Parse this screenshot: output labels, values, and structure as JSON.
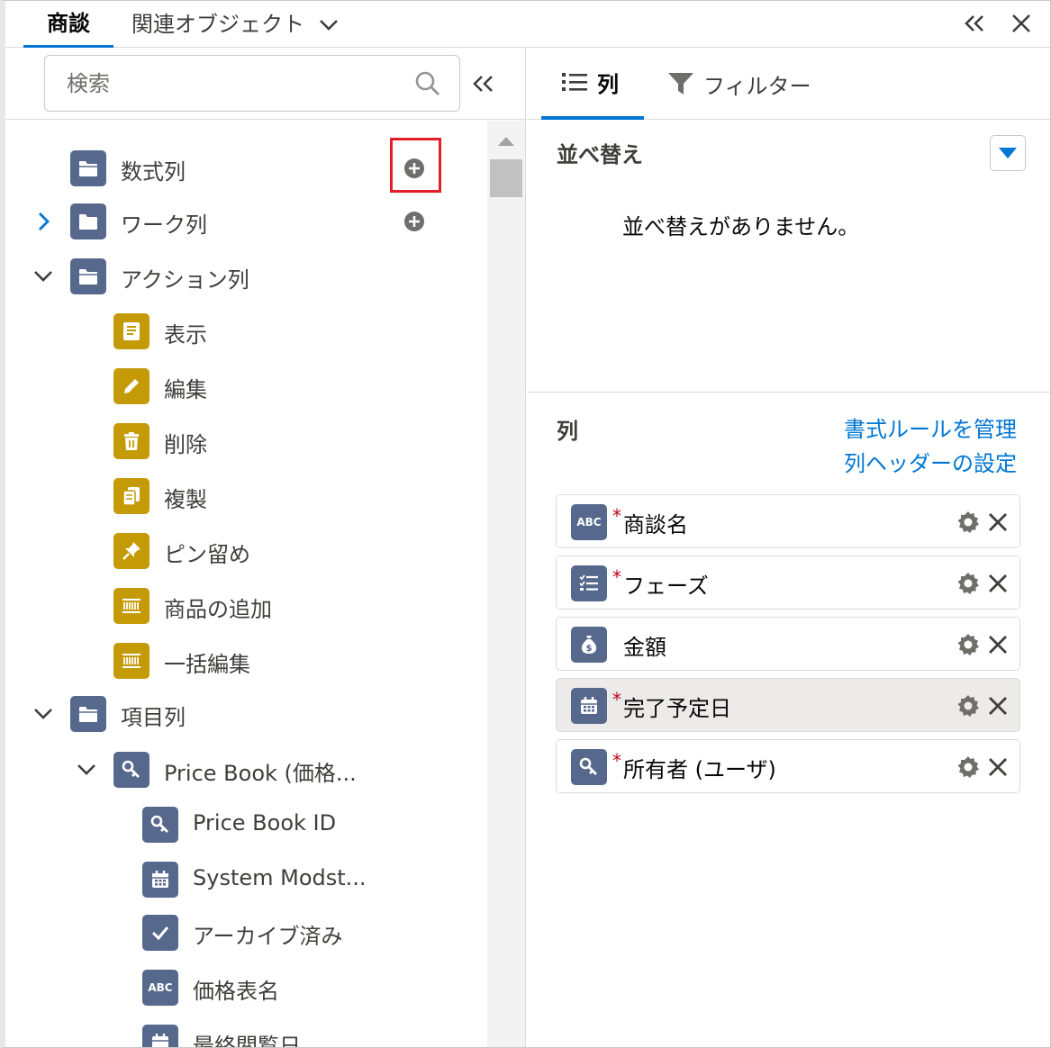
{
  "top_tabs": {
    "main": "商談",
    "related": "関連オブジェクト"
  },
  "search": {
    "placeholder": "検索"
  },
  "tree": [
    {
      "label": "数式列",
      "icon": "folder-icon",
      "icon_color": "#56688c",
      "expander": "none",
      "add": true
    },
    {
      "label": "ワーク列",
      "icon": "folder-icon",
      "icon_color": "#56688c",
      "expander": "collapsed",
      "add": true
    },
    {
      "label": "アクション列",
      "icon": "folder-icon",
      "icon_color": "#56688c",
      "expander": "expanded",
      "add": false
    },
    {
      "label": "表示",
      "icon": "record-view-icon",
      "icon_color": "#c49b07"
    },
    {
      "label": "編集",
      "icon": "pencil-icon",
      "icon_color": "#c49b07"
    },
    {
      "label": "削除",
      "icon": "trash-icon",
      "icon_color": "#c49b07"
    },
    {
      "label": "複製",
      "icon": "copy-icon",
      "icon_color": "#c49b07"
    },
    {
      "label": "ピン留め",
      "icon": "pin-icon",
      "icon_color": "#c49b07"
    },
    {
      "label": "商品の追加",
      "icon": "barcode-icon",
      "icon_color": "#c49b07"
    },
    {
      "label": "一括編集",
      "icon": "barcode-icon",
      "icon_color": "#c49b07"
    },
    {
      "label": "項目列",
      "icon": "folder-icon",
      "icon_color": "#56688c",
      "expander": "expanded"
    },
    {
      "label": "Price Book (価格...",
      "icon": "lookup-icon",
      "icon_color": "#56688c",
      "expander": "expanded"
    },
    {
      "label": "Price Book ID",
      "icon": "lookup-icon",
      "icon_color": "#56688c"
    },
    {
      "label": "System Modst...",
      "icon": "calendar-icon",
      "icon_color": "#56688c"
    },
    {
      "label": "アーカイブ済み",
      "icon": "checkbox-icon",
      "icon_color": "#56688c"
    },
    {
      "label": "価格表名",
      "icon": "text-abc-icon",
      "icon_color": "#56688c"
    },
    {
      "label": "最終閲覧日",
      "icon": "calendar-icon",
      "icon_color": "#56688c"
    }
  ],
  "right_tabs": {
    "columns": "列",
    "filter": "フィルター"
  },
  "sort": {
    "title": "並べ替え",
    "empty": "並べ替えがありません。"
  },
  "columns": {
    "title": "列",
    "link_format_rules": "書式ルールを管理",
    "link_header_settings": "列ヘッダーの設定",
    "items": [
      {
        "name": "商談名",
        "required": "*",
        "icon": "text-abc-icon",
        "selected": false
      },
      {
        "name": "フェーズ",
        "required": "*",
        "icon": "picklist-icon",
        "selected": false
      },
      {
        "name": "金額",
        "required": "",
        "icon": "currency-icon",
        "selected": false
      },
      {
        "name": "完了予定日",
        "required": "*",
        "icon": "calendar-icon",
        "selected": true
      },
      {
        "name": "所有者 (ユーザ)",
        "required": "*",
        "icon": "lookup-icon",
        "selected": false
      }
    ]
  },
  "colors": {
    "accent": "#0176d3",
    "navy_icon": "#56688c",
    "gold_icon": "#c49b07",
    "highlight_box": "#e41d2a",
    "required_mark": "#ba0517"
  }
}
